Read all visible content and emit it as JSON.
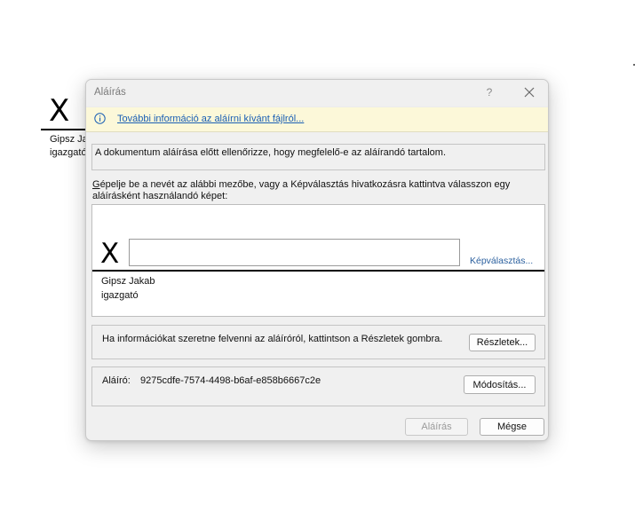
{
  "background_document": {
    "x_mark": "X",
    "name": "Gipsz Ja",
    "title": "igazgató"
  },
  "dialog": {
    "title": "Aláírás",
    "help_label": "?",
    "info_link": "További információ az aláírni kívánt fájlról...",
    "check_notice": "A dokumentum aláírása előtt ellenőrizze, hogy megfelelő-e az aláírandó tartalom.",
    "instruction_first_letter": "G",
    "instruction_rest": "épelje be a nevét az alábbi mezőbe, vagy a Képválasztás hivatkozásra kattintva válasszon egy aláírásként használandó képet:",
    "signature_x": "X",
    "signature_input_value": "",
    "image_select_link": "Képválasztás...",
    "signer_name": "Gipsz Jakab",
    "signer_title": "igazgató",
    "details_text": "Ha információkat szeretne felvenni az aláíróról, kattintson a Részletek gombra.",
    "details_button": "Részletek...",
    "signer_label": "Aláíró:",
    "signer_id": "9275cdfe-7574-4498-b6af-e858b6667c2e",
    "modify_button": "Módosítás...",
    "sign_button": "Aláírás",
    "cancel_button": "Mégse"
  },
  "colors": {
    "info_bar": "#fcf8d9",
    "link": "#1a5fb4",
    "dialog_bg": "#f0f0f0"
  },
  "icons": {
    "info": "info-circle-icon",
    "close": "close-icon"
  }
}
